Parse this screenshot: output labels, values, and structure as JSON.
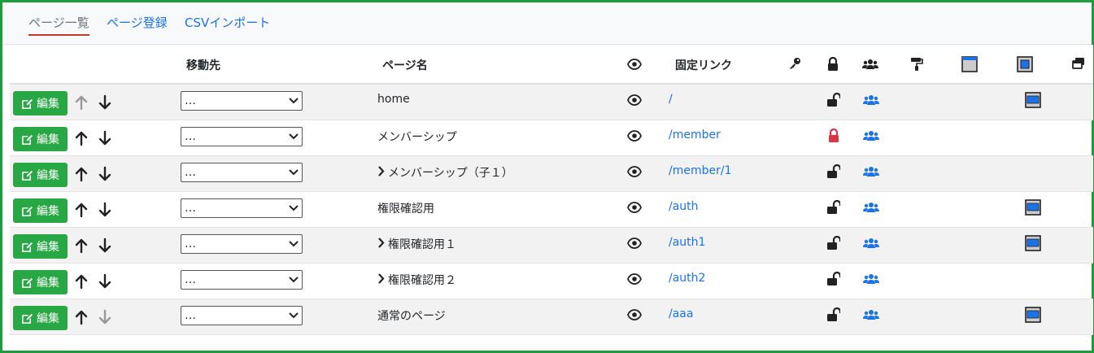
{
  "tabs": [
    {
      "label": "ページ一覧",
      "active": true
    },
    {
      "label": "ページ登録",
      "active": false
    },
    {
      "label": "CSVインポート",
      "active": false
    }
  ],
  "table": {
    "headers": {
      "move_to": "移動先",
      "page_name": "ページ名",
      "fixed_link": "固定リンク"
    },
    "header_icons": [
      "eye-icon",
      "key-icon",
      "lock-icon",
      "users-icon",
      "paint-roller-icon",
      "window-frame-icon",
      "frame-inner-icon",
      "windows-icon"
    ],
    "edit_label": "編集",
    "select_placeholder": "…",
    "rows": [
      {
        "name": "home",
        "indent": false,
        "link": "/",
        "locked": false,
        "up_enabled": false,
        "down_enabled": true,
        "frame": true
      },
      {
        "name": "メンバーシップ",
        "indent": false,
        "link": "/member",
        "locked": true,
        "up_enabled": true,
        "down_enabled": true,
        "frame": false
      },
      {
        "name": "メンバーシップ（子１）",
        "indent": true,
        "link": "/member/1",
        "locked": false,
        "up_enabled": true,
        "down_enabled": true,
        "frame": false
      },
      {
        "name": "権限確認用",
        "indent": false,
        "link": "/auth",
        "locked": false,
        "up_enabled": true,
        "down_enabled": true,
        "frame": true
      },
      {
        "name": "権限確認用１",
        "indent": true,
        "link": "/auth1",
        "locked": false,
        "up_enabled": true,
        "down_enabled": true,
        "frame": true
      },
      {
        "name": "権限確認用２",
        "indent": true,
        "link": "/auth2",
        "locked": false,
        "up_enabled": true,
        "down_enabled": true,
        "frame": false
      },
      {
        "name": "通常のページ",
        "indent": false,
        "link": "/aaa",
        "locked": false,
        "up_enabled": true,
        "down_enabled": false,
        "frame": true
      }
    ]
  },
  "colors": {
    "accent": "#1a73e8",
    "edit_button": "#28a745",
    "locked": "#dc3545",
    "border": "#1e9b3a"
  }
}
